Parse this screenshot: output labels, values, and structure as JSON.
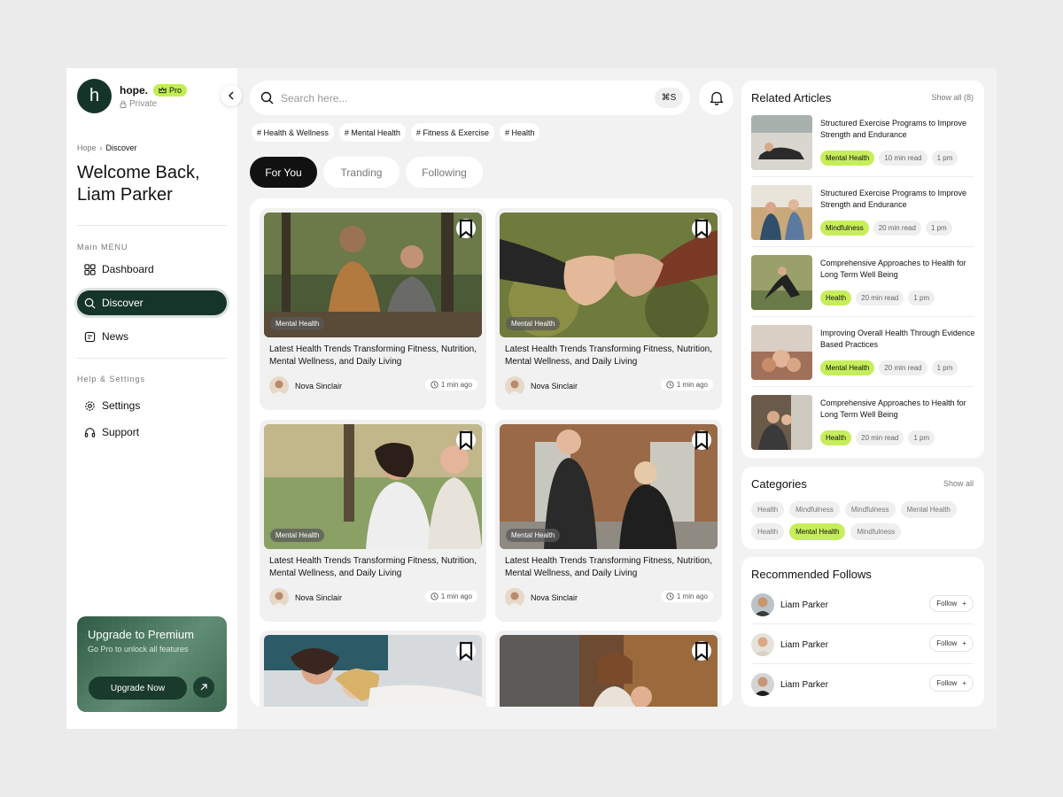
{
  "brand": {
    "logo_letter": "h",
    "name": "hope.",
    "badge": "Pro",
    "privacy": "Private"
  },
  "breadcrumb": {
    "root": "Hope",
    "current": "Discover"
  },
  "welcome": {
    "line1": "Welcome Back,",
    "line2": "Liam Parker"
  },
  "sidebar": {
    "main_menu_label": "Main MENU",
    "main_items": [
      {
        "label": "Dashboard",
        "icon": "grid-icon"
      },
      {
        "label": "Discover",
        "icon": "search-icon",
        "active": true
      },
      {
        "label": "News",
        "icon": "news-icon"
      }
    ],
    "help_label": "Help & Settings",
    "help_items": [
      {
        "label": "Settings",
        "icon": "gear-icon"
      },
      {
        "label": "Support",
        "icon": "headset-icon"
      }
    ]
  },
  "upgrade": {
    "title": "Upgrade to Premium",
    "subtitle": "Go Pro to unlock all features",
    "button": "Upgrade Now"
  },
  "search": {
    "placeholder": "Search here...",
    "shortcut": "⌘S"
  },
  "tags": [
    "# Health & Wellness",
    "# Mental Health",
    "# Fitness & Exercise",
    "# Health"
  ],
  "tabs": [
    {
      "label": "For You",
      "active": true
    },
    {
      "label": "Tranding"
    },
    {
      "label": "Following"
    }
  ],
  "posts": [
    {
      "category": "Mental Health",
      "title": "Latest Health Trends Transforming Fitness, Nutrition, Mental Wellness, and Daily Living",
      "author": "Nova Sinclair",
      "time": "1 min ago"
    },
    {
      "category": "Mental Health",
      "title": "Latest Health Trends Transforming Fitness, Nutrition, Mental Wellness, and Daily Living",
      "author": "Nova Sinclair",
      "time": "1 min ago"
    },
    {
      "category": "Mental Health",
      "title": "Latest Health Trends Transforming Fitness, Nutrition, Mental Wellness, and Daily Living",
      "author": "Nova Sinclair",
      "time": "1 min ago"
    },
    {
      "category": "Mental Health",
      "title": "Latest Health Trends Transforming Fitness, Nutrition, Mental Wellness, and Daily Living",
      "author": "Nova Sinclair",
      "time": "1 min ago"
    }
  ],
  "related": {
    "title": "Related Articles",
    "show_all": "Show all (8)",
    "items": [
      {
        "title": "Structured Exercise Programs to Improve Strength and Endurance",
        "tag": "Mental Health",
        "read": "10 min read",
        "time": "1 pm"
      },
      {
        "title": "Structured Exercise Programs to Improve Strength and Endurance",
        "tag": "Mindfulness",
        "read": "20 min read",
        "time": "1 pm"
      },
      {
        "title": "Comprehensive Approaches to Health for Long Term Well Being",
        "tag": "Health",
        "read": "20 min read",
        "time": "1 pm"
      },
      {
        "title": "Improving Overall Health Through Evidence Based Practices",
        "tag": "Mental Health",
        "read": "20 min read",
        "time": "1 pm"
      },
      {
        "title": "Comprehensive Approaches to Health for Long Term Well Being",
        "tag": "Health",
        "read": "20 min read",
        "time": "1 pm"
      }
    ]
  },
  "categories": {
    "title": "Categories",
    "show_all": "Show all",
    "items": [
      {
        "label": "Health"
      },
      {
        "label": "Mindfulness"
      },
      {
        "label": "Mindfulness"
      },
      {
        "label": "Mental Health"
      },
      {
        "label": "Health"
      },
      {
        "label": "Mental Health",
        "active": true
      },
      {
        "label": "Mindfulness"
      }
    ]
  },
  "recommended": {
    "title": "Recommended Follows",
    "follow_label": "Follow",
    "items": [
      {
        "name": "Liam Parker"
      },
      {
        "name": "Liam Parker"
      },
      {
        "name": "Liam Parker"
      }
    ]
  },
  "colors": {
    "dark_green": "#16352a",
    "lime": "#c6ee5a",
    "background": "#f2f2f2"
  }
}
